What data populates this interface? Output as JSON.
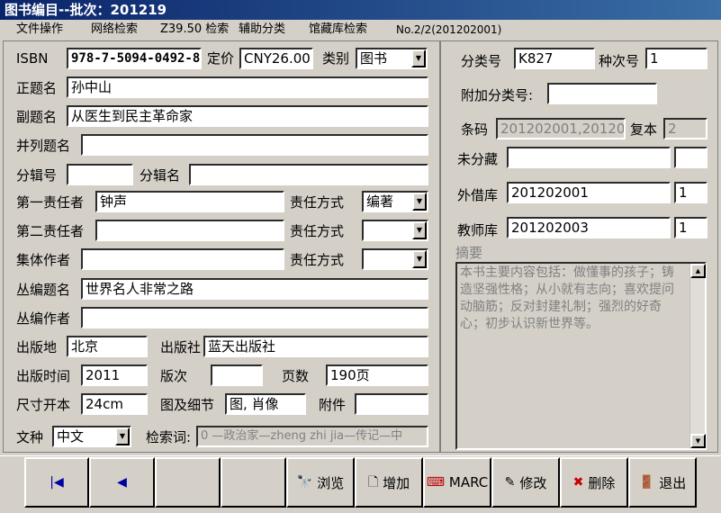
{
  "window": {
    "title": "图书编目--批次：201219"
  },
  "menu": {
    "items": [
      "文件操作",
      "网络检索",
      "Z39.50 检索",
      "辅助分类",
      "馆藏库检索"
    ],
    "record_no": "No.2/2(201202001)"
  },
  "form": {
    "isbn_label": "ISBN",
    "isbn": "978-7-5094-0492-8",
    "price_label": "定价",
    "price": "CNY26.00",
    "category_label": "类别",
    "category": "图书",
    "title_label": "正题名",
    "title": "孙中山",
    "subtitle_label": "副题名",
    "subtitle": "从医生到民主革命家",
    "parallel_title_label": "并列题名",
    "parallel_title": "",
    "part_no_label": "分辑号",
    "part_no": "",
    "part_name_label": "分辑名",
    "part_name": "",
    "resp1_label": "第一责任者",
    "resp1": "钟声",
    "resp_mode1_label": "责任方式",
    "resp_mode1": "编著",
    "resp2_label": "第二责任者",
    "resp2": "",
    "resp_mode2_label": "责任方式",
    "resp_mode2": "",
    "collective_label": "集体作者",
    "collective": "",
    "resp_mode3_label": "责任方式",
    "resp_mode3": "",
    "series_title_label": "丛编题名",
    "series_title": "世界名人非常之路",
    "series_author_label": "丛编作者",
    "series_author": "",
    "pub_place_label": "出版地",
    "pub_place": "北京",
    "publisher_label": "出版社",
    "publisher": "蓝天出版社",
    "pub_date_label": "出版时间",
    "pub_date": "2011",
    "edition_label": "版次",
    "edition": "",
    "pages_label": "页数",
    "pages": "190页",
    "size_label": "尺寸开本",
    "size": "24cm",
    "illus_label": "图及细节",
    "illus": "图, 肖像",
    "attach_label": "附件",
    "attach": "",
    "language_label": "文种",
    "language": "中文",
    "keywords_label": "检索词:",
    "keywords": "0 —政治家—zheng zhi jia—传记—中"
  },
  "right": {
    "class_no_label": "分类号",
    "class_no": "K827",
    "seq_no_label": "种次号",
    "seq_no": "1",
    "extra_class_label": "附加分类号:",
    "extra_class": "",
    "barcode_label": "条码",
    "barcode": "201202001,201202",
    "copies_label": "复本",
    "copies": "2",
    "unsorted_label": "未分藏",
    "unsorted": "",
    "unsorted_count": "",
    "lending_label": "外借库",
    "lending": "201202001",
    "lending_count": "1",
    "teacher_label": "教师库",
    "teacher": "201202003",
    "teacher_count": "1",
    "summary_label": "摘要",
    "summary": "本书主要内容包括：做懂事的孩子；铸造坚强性格；从小就有志向；喜欢提问动脑筋；反对封建礼制；强烈的好奇心；初步认识新世界等。"
  },
  "buttons": {
    "browse": "浏览",
    "add": "增加",
    "marc": "MARC",
    "edit": "修改",
    "delete": "删除",
    "exit": "退出"
  }
}
